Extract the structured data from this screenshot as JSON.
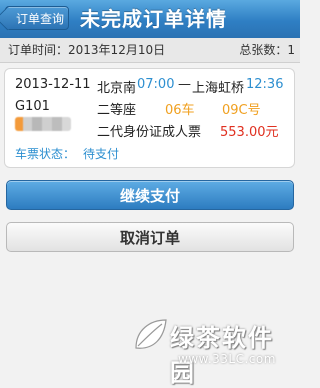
{
  "header": {
    "back_label": "订单查询",
    "title": "未完成订单详情"
  },
  "summary": {
    "order_time_label": "订单时间：",
    "order_time": "2013年12月10日",
    "total_label": "总张数：",
    "total_count": "1"
  },
  "ticket": {
    "date": "2013-12-11",
    "from_station": "北京南",
    "depart_time": "07:00",
    "separator": "—",
    "to_station": "上海虹桥",
    "arrive_time": "12:36",
    "train_no": "G101",
    "seat_class": "二等座",
    "car": "06车",
    "seat": "09C号",
    "passenger_type": "二代身份证成人票",
    "price": "553.00元",
    "status_label": "车票状态：",
    "status_value": "待支付"
  },
  "actions": {
    "continue_pay": "继续支付",
    "cancel_order": "取消订单"
  },
  "watermark": {
    "brand": "绿茶软件园",
    "url": "www.33LC.com"
  }
}
